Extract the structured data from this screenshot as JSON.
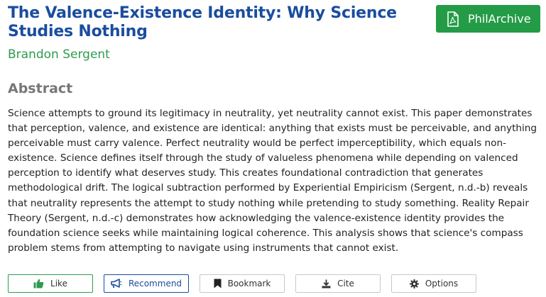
{
  "paper": {
    "title": "The Valence-Existence Identity: Why Science Studies Nothing",
    "author": "Brandon Sergent"
  },
  "archive_button": {
    "label": "PhilArchive",
    "icon": "pdf-file-icon"
  },
  "abstract": {
    "heading": "Abstract",
    "text": "Science attempts to ground its legitimacy in neutrality, yet neutrality cannot exist. This paper demonstrates that perception, valence, and existence are identical: anything that exists must be perceivable, and anything perceivable must carry valence. Perfect neutrality would be perfect imperceptibility, which equals non-existence. Science defines itself through the study of valueless phenomena while depending on valenced perception to identify what deserves study. This creates foundational contradiction that generates methodological drift. The logical subtraction performed by Experiential Empiricism (Sergent, n.d.-b) reveals that neutrality represents the attempt to study nothing while pretending to study something. Reality Repair Theory (Sergent, n.d.-c) demonstrates how acknowledging the valence-existence identity provides the foundation science seeks while maintaining logical coherence. This analysis shows that science's compass problem stems from attempting to navigate using instruments that cannot exist."
  },
  "actions": {
    "like": {
      "label": "Like",
      "icon": "thumbs-up-icon",
      "color": "#2e9b4e"
    },
    "recommend": {
      "label": "Recommend",
      "icon": "bullhorn-icon",
      "color": "#1a4d9e"
    },
    "bookmark": {
      "label": "Bookmark",
      "icon": "bookmark-icon"
    },
    "cite": {
      "label": "Cite",
      "icon": "download-icon"
    },
    "options": {
      "label": "Options",
      "icon": "gear-icon"
    }
  },
  "colors": {
    "title": "#1a4d9e",
    "author": "#2e9b4e",
    "archive_button": "#249c47",
    "heading": "#777777"
  }
}
